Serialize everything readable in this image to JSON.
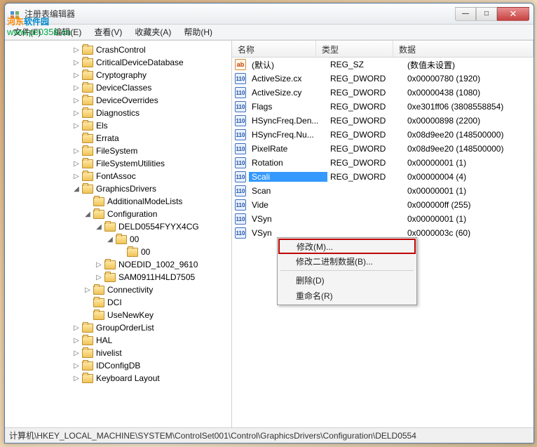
{
  "window": {
    "title": "注册表编辑器",
    "minimize": "—",
    "maximize": "□",
    "close": "✕"
  },
  "watermark": {
    "brand_a": "河东",
    "brand_b": "软件园",
    "url": "www.pc0359.cn"
  },
  "menu": {
    "file": "文件(F)",
    "edit": "编辑(E)",
    "view": "查看(V)",
    "favorites": "收藏夹(A)",
    "help": "帮助(H)"
  },
  "tree_items": [
    {
      "depth": 6,
      "exp": "▷",
      "label": "CrashControl"
    },
    {
      "depth": 6,
      "exp": "▷",
      "label": "CriticalDeviceDatabase"
    },
    {
      "depth": 6,
      "exp": "▷",
      "label": "Cryptography"
    },
    {
      "depth": 6,
      "exp": "▷",
      "label": "DeviceClasses"
    },
    {
      "depth": 6,
      "exp": "▷",
      "label": "DeviceOverrides"
    },
    {
      "depth": 6,
      "exp": "▷",
      "label": "Diagnostics"
    },
    {
      "depth": 6,
      "exp": "▷",
      "label": "Els"
    },
    {
      "depth": 6,
      "exp": "",
      "label": "Errata"
    },
    {
      "depth": 6,
      "exp": "▷",
      "label": "FileSystem"
    },
    {
      "depth": 6,
      "exp": "▷",
      "label": "FileSystemUtilities"
    },
    {
      "depth": 6,
      "exp": "▷",
      "label": "FontAssoc"
    },
    {
      "depth": 6,
      "exp": "◢",
      "label": "GraphicsDrivers"
    },
    {
      "depth": 7,
      "exp": "",
      "label": "AdditionalModeLists"
    },
    {
      "depth": 7,
      "exp": "◢",
      "label": "Configuration"
    },
    {
      "depth": 8,
      "exp": "◢",
      "label": "DELD0554FYYX4CG"
    },
    {
      "depth": 9,
      "exp": "◢",
      "label": "00"
    },
    {
      "depth": 10,
      "exp": "",
      "label": "00"
    },
    {
      "depth": 8,
      "exp": "▷",
      "label": "NOEDID_1002_9610"
    },
    {
      "depth": 8,
      "exp": "▷",
      "label": "SAM0911H4LD7505"
    },
    {
      "depth": 7,
      "exp": "▷",
      "label": "Connectivity"
    },
    {
      "depth": 7,
      "exp": "",
      "label": "DCI"
    },
    {
      "depth": 7,
      "exp": "",
      "label": "UseNewKey"
    },
    {
      "depth": 6,
      "exp": "▷",
      "label": "GroupOrderList"
    },
    {
      "depth": 6,
      "exp": "▷",
      "label": "HAL"
    },
    {
      "depth": 6,
      "exp": "▷",
      "label": "hivelist"
    },
    {
      "depth": 6,
      "exp": "▷",
      "label": "IDConfigDB"
    },
    {
      "depth": 6,
      "exp": "▷",
      "label": "Keyboard Layout"
    }
  ],
  "columns": {
    "name": "名称",
    "type": "类型",
    "data": "数据"
  },
  "rows": [
    {
      "icon": "str",
      "name": "(默认)",
      "type": "REG_SZ",
      "data": "(数值未设置)"
    },
    {
      "icon": "bin",
      "name": "ActiveSize.cx",
      "type": "REG_DWORD",
      "data": "0x00000780 (1920)"
    },
    {
      "icon": "bin",
      "name": "ActiveSize.cy",
      "type": "REG_DWORD",
      "data": "0x00000438 (1080)"
    },
    {
      "icon": "bin",
      "name": "Flags",
      "type": "REG_DWORD",
      "data": "0xe301ff06 (3808558854)"
    },
    {
      "icon": "bin",
      "name": "HSyncFreq.Den...",
      "type": "REG_DWORD",
      "data": "0x00000898 (2200)"
    },
    {
      "icon": "bin",
      "name": "HSyncFreq.Nu...",
      "type": "REG_DWORD",
      "data": "0x08d9ee20 (148500000)"
    },
    {
      "icon": "bin",
      "name": "PixelRate",
      "type": "REG_DWORD",
      "data": "0x08d9ee20 (148500000)"
    },
    {
      "icon": "bin",
      "name": "Rotation",
      "type": "REG_DWORD",
      "data": "0x00000001 (1)"
    },
    {
      "icon": "bin",
      "name": "Scali",
      "type": "REG_DWORD",
      "data": "0x00000004 (4)",
      "sel": true
    },
    {
      "icon": "bin",
      "name": "Scan",
      "type": "",
      "data": "0x00000001 (1)"
    },
    {
      "icon": "bin",
      "name": "Vide",
      "type": "",
      "data": "0x000000ff (255)"
    },
    {
      "icon": "bin",
      "name": "VSyn",
      "type": "",
      "data": "0x00000001 (1)"
    },
    {
      "icon": "bin",
      "name": "VSyn",
      "type": "",
      "data": "0x0000003c (60)"
    }
  ],
  "contextmenu": {
    "modify": "修改(M)...",
    "modify_binary": "修改二进制数据(B)...",
    "delete": "删除(D)",
    "rename": "重命名(R)"
  },
  "icon_glyph": {
    "str": "ab",
    "bin": "011\n110"
  },
  "statusbar": "计算机\\HKEY_LOCAL_MACHINE\\SYSTEM\\ControlSet001\\Control\\GraphicsDrivers\\Configuration\\DELD0554"
}
